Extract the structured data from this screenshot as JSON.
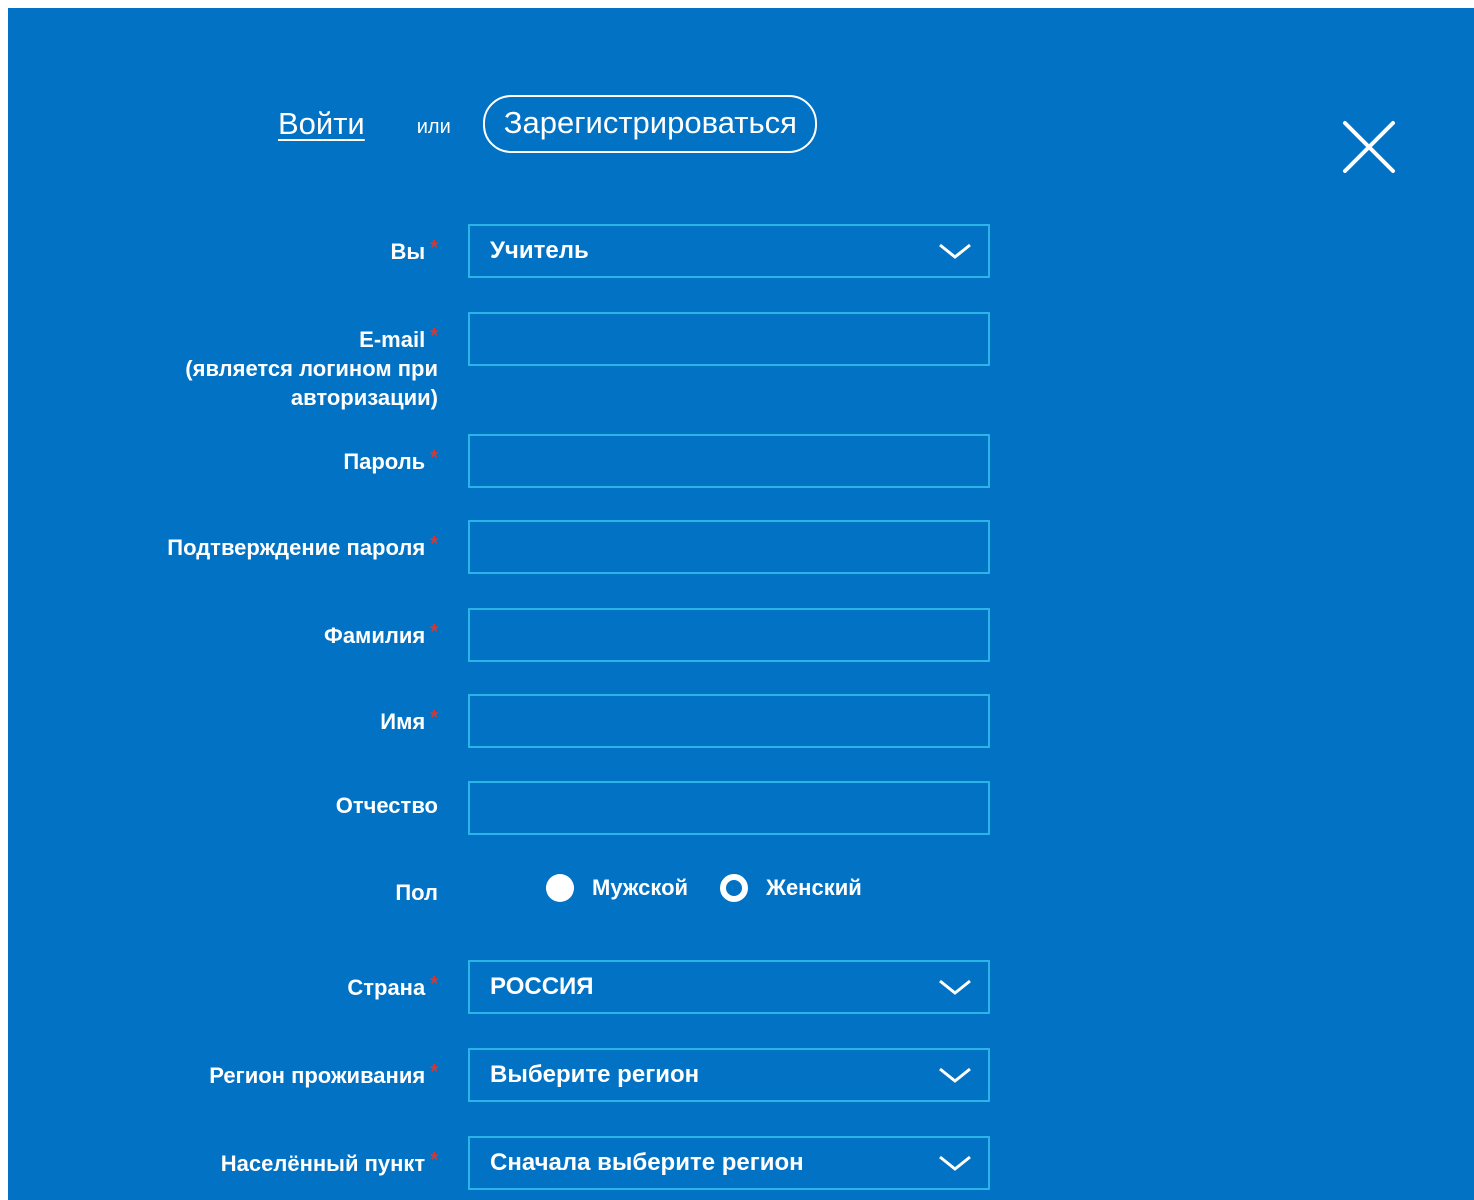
{
  "tabs": {
    "login": "Войти",
    "or": "или",
    "register": "Зарегистрироваться"
  },
  "form": {
    "role": {
      "label": "Вы",
      "required_mark": "*",
      "value": "Учитель"
    },
    "email": {
      "label_line1": "E-mail",
      "label_line2": "(является логином при",
      "label_line3": "авторизации)",
      "required_mark": "*",
      "value": ""
    },
    "password": {
      "label": "Пароль",
      "required_mark": "*",
      "value": ""
    },
    "password_confirm": {
      "label": "Подтверждение пароля",
      "required_mark": "*",
      "value": ""
    },
    "surname": {
      "label": "Фамилия",
      "required_mark": "*",
      "value": ""
    },
    "name": {
      "label": "Имя",
      "required_mark": "*",
      "value": ""
    },
    "patronymic": {
      "label": "Отчество",
      "value": ""
    },
    "gender": {
      "label": "Пол",
      "options": [
        "Мужской",
        "Женский"
      ],
      "selected": "Женский"
    },
    "country": {
      "label": "Страна",
      "required_mark": "*",
      "value": "РОССИЯ"
    },
    "region": {
      "label": "Регион проживания",
      "required_mark": "*",
      "value": "Выберите регион"
    },
    "locality": {
      "label": "Населённый пункт",
      "required_mark": "*",
      "value": "Сначала выберите регион"
    }
  },
  "colors": {
    "background": "#0172c4",
    "field_border": "#2ab4e8",
    "required": "#e2342b",
    "text": "#ffffff"
  },
  "icons": {
    "close": "close-icon",
    "dropdown": "chevron-down-icon"
  }
}
